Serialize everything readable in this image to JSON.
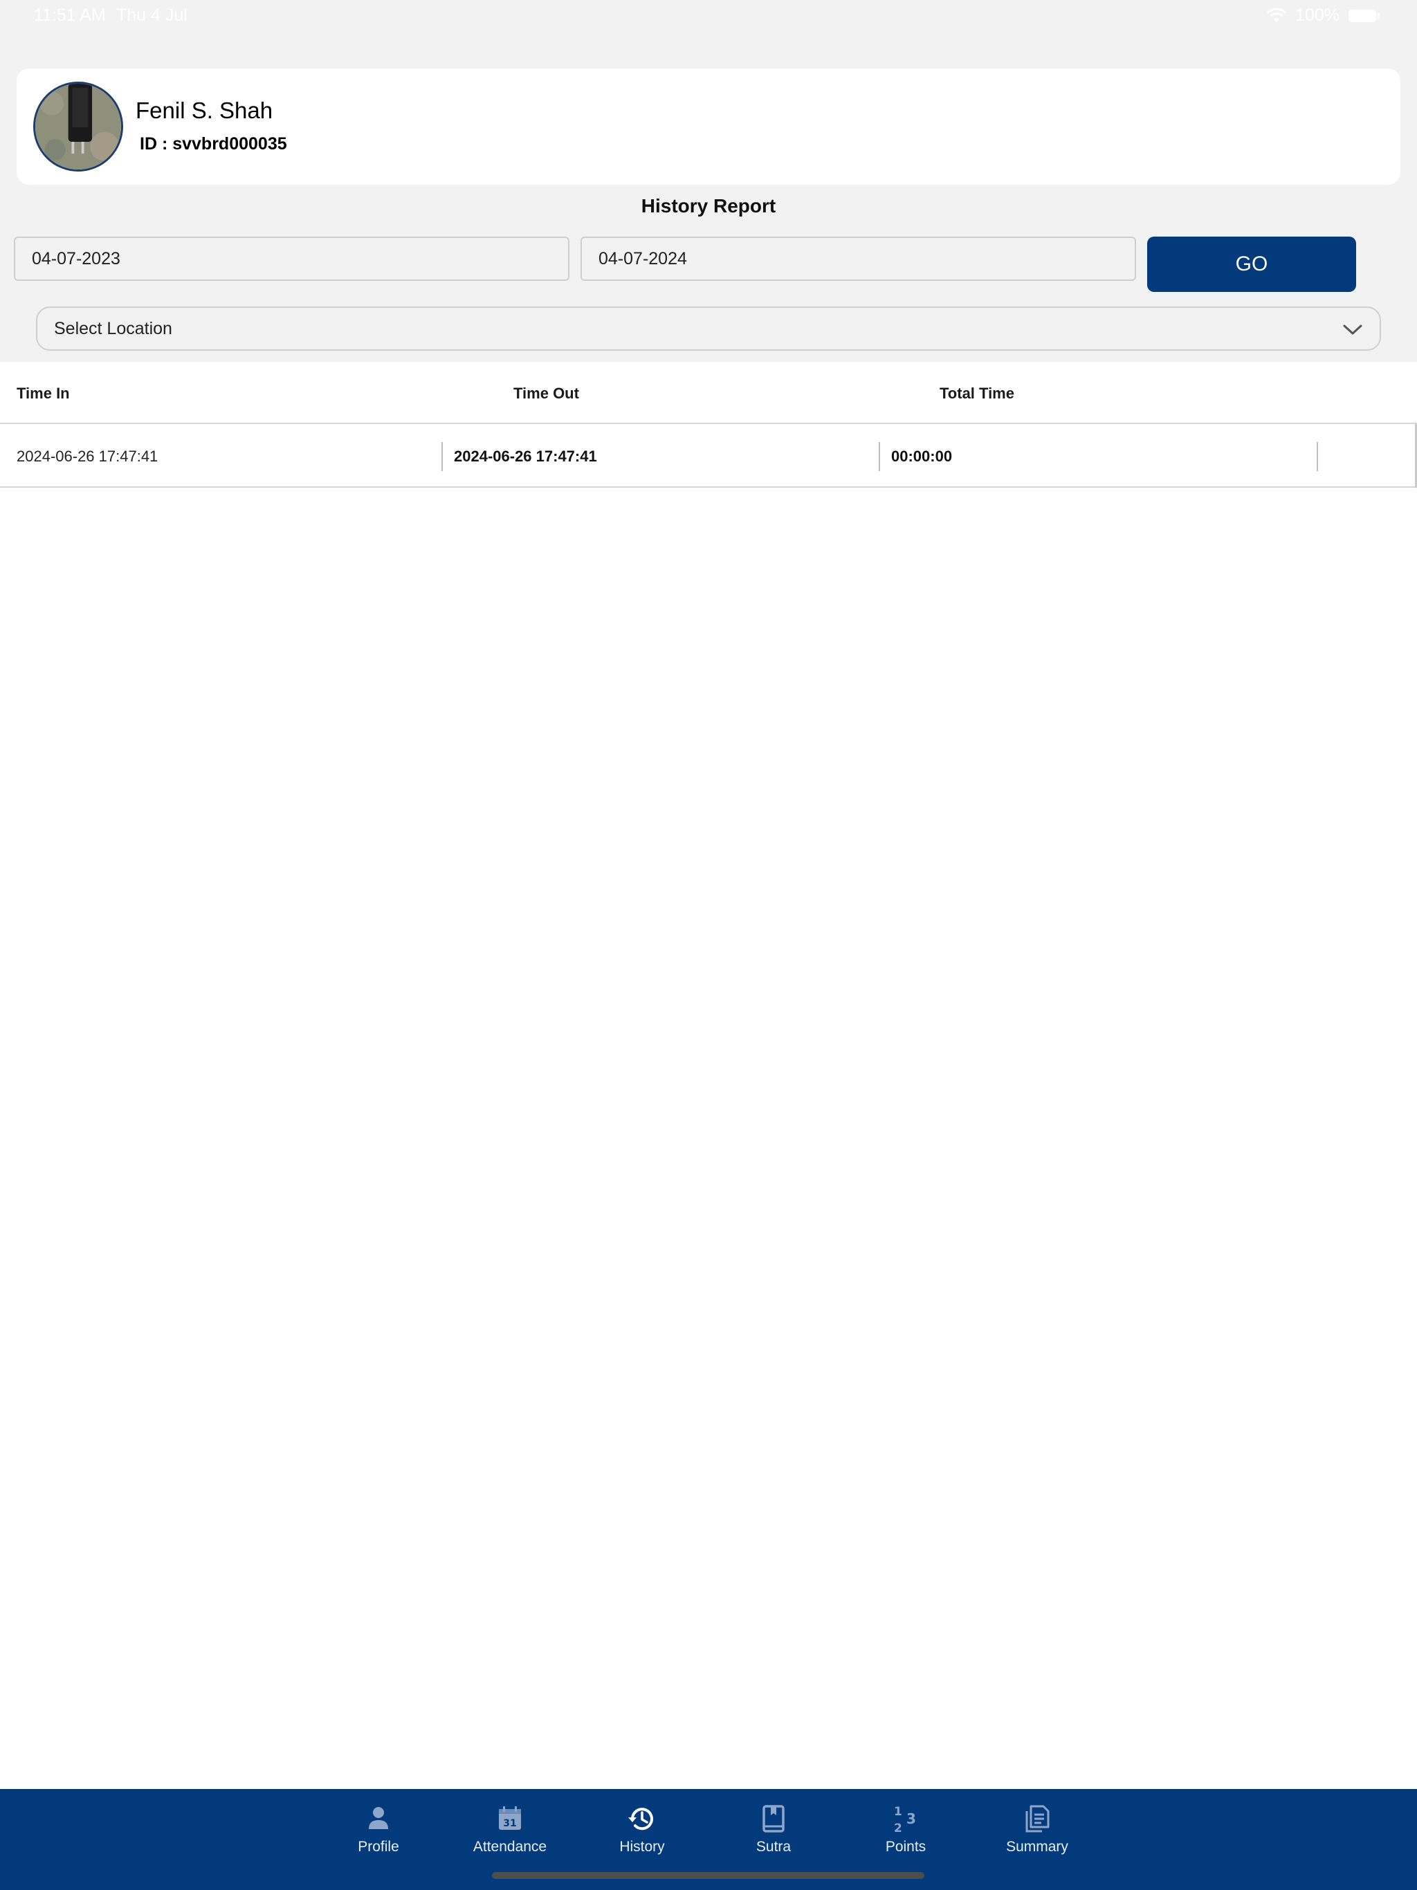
{
  "status_bar": {
    "time": "11:51 AM",
    "date": "Thu 4 Jul",
    "battery": "100%"
  },
  "profile": {
    "name": "Fenil S. Shah",
    "id_label": "ID : svvbrd000035"
  },
  "page": {
    "title": "History Report"
  },
  "filters": {
    "from_date": "04-07-2023",
    "to_date": "04-07-2024",
    "go_label": "GO",
    "location_placeholder": "Select Location"
  },
  "table": {
    "columns": [
      "Time In",
      "Time Out",
      "Total Time"
    ],
    "rows": [
      {
        "time_in": "2024-06-26 17:47:41",
        "time_out": "2024-06-26 17:47:41",
        "total": "00:00:00"
      }
    ]
  },
  "tab_bar": {
    "active": "History",
    "items": [
      {
        "label": "Profile",
        "icon": "person-icon"
      },
      {
        "label": "Attendance",
        "icon": "calendar-icon"
      },
      {
        "label": "History",
        "icon": "history-icon"
      },
      {
        "label": "Sutra",
        "icon": "book-icon"
      },
      {
        "label": "Points",
        "icon": "numbers-icon"
      },
      {
        "label": "Summary",
        "icon": "document-icon"
      }
    ]
  },
  "colors": {
    "primary": "#033a7b",
    "background": "#f2f2f2",
    "card": "#ffffff"
  }
}
